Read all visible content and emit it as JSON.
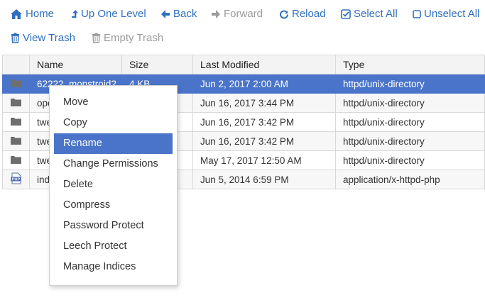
{
  "toolbar": {
    "home": "Home",
    "up_one_level": "Up One Level",
    "back": "Back",
    "forward": "Forward",
    "reload": "Reload",
    "select_all": "Select All",
    "unselect_all": "Unselect All",
    "view_trash": "View Trash",
    "empty_trash": "Empty Trash"
  },
  "table": {
    "headers": {
      "icon": "",
      "name": "Name",
      "size": "Size",
      "modified": "Last Modified",
      "type": "Type"
    },
    "rows": [
      {
        "icon": "folder-icon",
        "name": "62222_monstroid2",
        "size": "4 KB",
        "modified": "Jun 2, 2017 2:00 AM",
        "type": "httpd/unix-directory"
      },
      {
        "icon": "folder-icon",
        "name": "ope",
        "size": "",
        "modified": "Jun 16, 2017 3:44 PM",
        "type": "httpd/unix-directory"
      },
      {
        "icon": "folder-icon",
        "name": "twe",
        "size": "",
        "modified": "Jun 16, 2017 3:42 PM",
        "type": "httpd/unix-directory"
      },
      {
        "icon": "folder-icon",
        "name": "twe",
        "size": "",
        "modified": "Jun 16, 2017 3:42 PM",
        "type": "httpd/unix-directory"
      },
      {
        "icon": "folder-icon",
        "name": "twe",
        "size": "",
        "modified": "May 17, 2017 12:50 AM",
        "type": "httpd/unix-directory"
      },
      {
        "icon": "php-file-icon",
        "name": "ind",
        "size": "",
        "modified": "Jun 5, 2014 6:59 PM",
        "type": "application/x-httpd-php"
      }
    ]
  },
  "context_menu": {
    "items": [
      "Move",
      "Copy",
      "Rename",
      "Change Permissions",
      "Delete",
      "Compress",
      "Password Protect",
      "Leech Protect",
      "Manage Indices"
    ],
    "active": "Rename"
  },
  "colors": {
    "accent": "#2f6fbf",
    "selection": "#4a74c9",
    "disabled": "#9b9b9b"
  }
}
